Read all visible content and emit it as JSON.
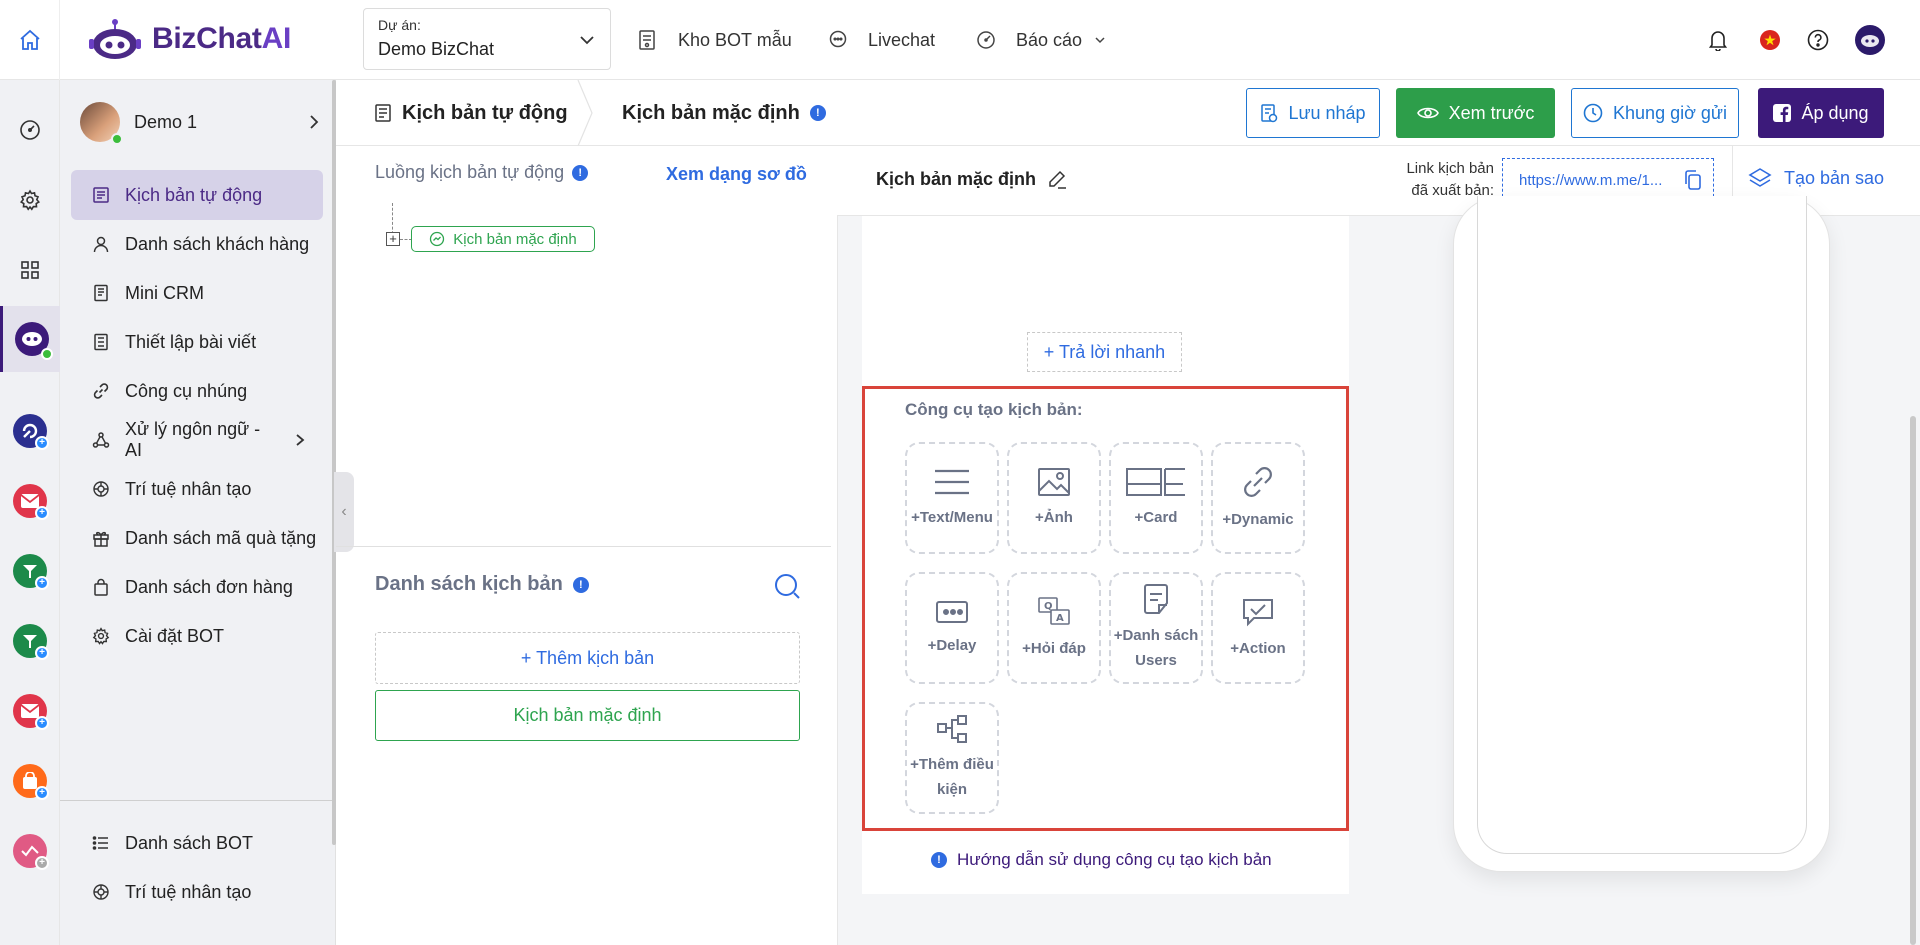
{
  "app": {
    "brand_text_1": "BizChat",
    "brand_text_2": "AI",
    "project_label": "Dự án:",
    "project_value": "Demo BizChat"
  },
  "topnav": [
    {
      "label": "Kho BOT mẫu",
      "icon": "bot-template-icon"
    },
    {
      "label": "Livechat",
      "icon": "chat-bubble-icon"
    },
    {
      "label": "Báo cáo",
      "icon": "dashboard-gauge-icon"
    }
  ],
  "user": {
    "name": "Demo 1"
  },
  "sidebar": {
    "items": [
      {
        "label": "Kịch bản tự động",
        "icon": "script-list-icon",
        "active": true
      },
      {
        "label": "Danh sách khách hàng",
        "icon": "user-icon"
      },
      {
        "label": "Mini CRM",
        "icon": "crm-doc-icon"
      },
      {
        "label": "Thiết lập bài viết",
        "icon": "post-doc-icon"
      },
      {
        "label": "Công cụ nhúng",
        "icon": "link-icon"
      },
      {
        "label": "Xử lý ngôn ngữ - AI",
        "icon": "nlp-graph-icon",
        "has_submenu": true
      },
      {
        "label": "Trí tuệ nhân tạo",
        "icon": "openai-icon"
      },
      {
        "label": "Danh sách mã quà tặng",
        "icon": "gift-icon"
      },
      {
        "label": "Danh sách đơn hàng",
        "icon": "shopping-bag-icon"
      },
      {
        "label": "Cài đặt BOT",
        "icon": "gear-icon"
      }
    ],
    "bottom_items": [
      {
        "label": "Danh sách BOT",
        "icon": "list-icon"
      },
      {
        "label": "Trí tuệ nhân tạo",
        "icon": "openai-icon"
      }
    ]
  },
  "header": {
    "crumb_1": "Kịch bản tự động",
    "crumb_2": "Kịch bản mặc định",
    "btn_draft": "Lưu nháp",
    "btn_preview": "Xem trước",
    "btn_schedule": "Khung giờ gửi",
    "btn_apply": "Áp dụng"
  },
  "flow": {
    "title": "Luồng kịch bản tự động",
    "view_diagram": "Xem dạng sơ đồ",
    "node_label": "Kịch bản mặc định"
  },
  "script_list": {
    "title": "Danh sách kịch bản",
    "add_label": "+ Thêm kịch bản",
    "items": [
      "Kịch bản mặc định"
    ]
  },
  "editor": {
    "script_name": "Kịch bản mặc định",
    "link_label_1": "Link kịch bản",
    "link_label_2": "đã xuất bản:",
    "link_url": "https://www.m.me/1...",
    "clone_label": "Tạo bản sao",
    "quick_reply": "+ Trả lời nhanh",
    "tools_title": "Công cụ tạo kịch bản:",
    "guide": "Hướng dẫn sử dụng công cụ tạo kịch bản"
  },
  "tools": [
    {
      "label": "+Text/Menu",
      "icon": "text-menu-icon"
    },
    {
      "label": "+Ảnh",
      "icon": "image-icon"
    },
    {
      "label": "+Card",
      "icon": "card-icon"
    },
    {
      "label": "+Dynamic",
      "icon": "dynamic-link-icon"
    },
    {
      "label": "+Delay",
      "icon": "delay-icon"
    },
    {
      "label": "+Hỏi đáp",
      "icon": "qa-icon"
    },
    {
      "label": "+Danh sách Users",
      "icon": "user-list-doc-icon"
    },
    {
      "label": "+Action",
      "icon": "action-check-icon"
    },
    {
      "label": "+Thêm điều kiện",
      "icon": "condition-tree-icon"
    }
  ],
  "colors": {
    "brand_purple": "#3c1a7a",
    "primary_blue": "#2f6be0",
    "success_green": "#2d9e4a",
    "highlight_red": "#d9443a",
    "active_menu_bg": "#d6d2e8"
  }
}
